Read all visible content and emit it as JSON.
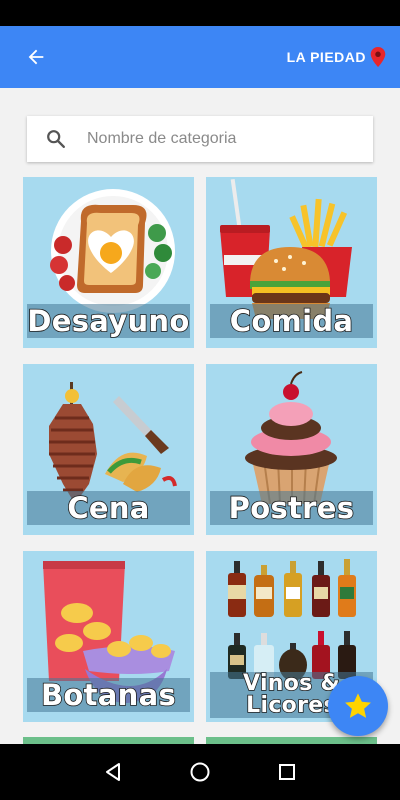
{
  "header": {
    "back_icon": "arrow-left-icon",
    "location_label": "LA PIEDAD",
    "location_icon": "map-pin-icon",
    "color": "#3d86f5"
  },
  "search": {
    "placeholder": "Nombre de categoria",
    "value": "",
    "icon": "search-icon"
  },
  "categories": [
    {
      "label": "Desayuno"
    },
    {
      "label": "Comida"
    },
    {
      "label": "Cena"
    },
    {
      "label": "Postres"
    },
    {
      "label": "Botanas"
    },
    {
      "label": "Vinos & Licores"
    }
  ],
  "fab": {
    "icon": "star-icon",
    "star_color": "#ffd400"
  },
  "nav": {
    "back_icon": "triangle-back-icon",
    "home_icon": "circle-home-icon",
    "recents_icon": "square-recents-icon"
  }
}
